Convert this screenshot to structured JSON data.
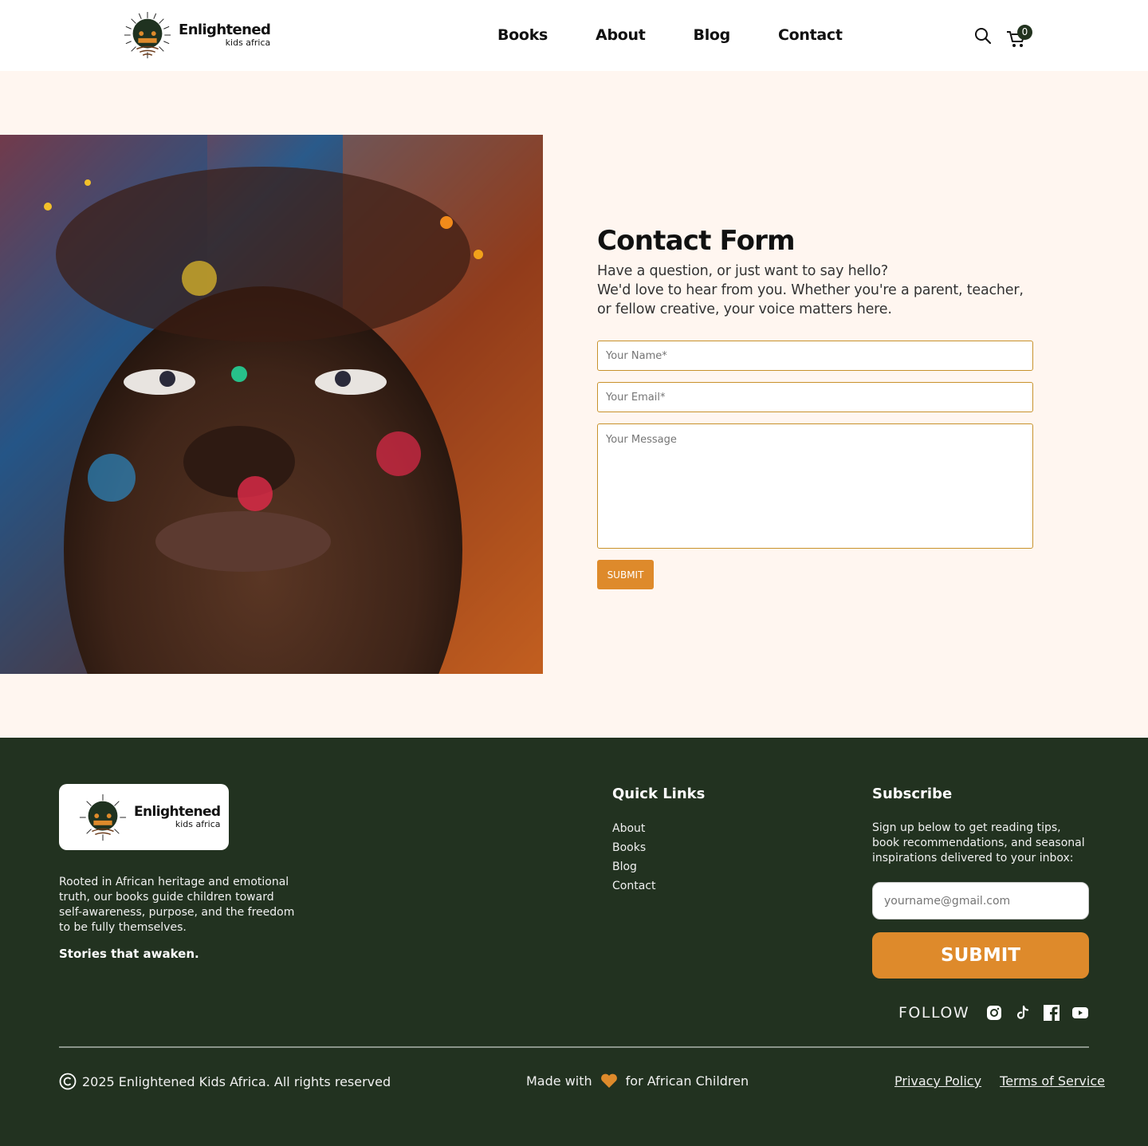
{
  "brand": {
    "name": "Enlightened",
    "sub": "kids africa"
  },
  "nav": {
    "items": [
      "Books",
      "About",
      "Blog",
      "Contact"
    ]
  },
  "cart": {
    "count": "0"
  },
  "contact": {
    "title": "Contact Form",
    "subtitle_line1": "Have a question,  or just want to say hello?",
    "subtitle_line2": "We'd love to hear from you. Whether you're a parent, teacher, or fellow creative, your voice matters here.",
    "name_placeholder": "Your Name*",
    "email_placeholder": "Your Email*",
    "message_placeholder": "Your Message",
    "submit_label": "SUBMIT"
  },
  "footer": {
    "about": "Rooted in African heritage and emotional truth, our books guide children toward self-awareness, purpose, and the freedom to be fully themselves.",
    "tagline": "Stories that awaken.",
    "quick_links_title": "Quick Links",
    "quick_links": [
      "About",
      "Books",
      "Blog",
      "Contact"
    ],
    "subscribe_title": "Subscribe",
    "subscribe_text": "Sign up below to get reading tips, book recommendations, and seasonal inspirations delivered to your inbox:",
    "email_placeholder": "yourname@gmail.com",
    "submit_label": "SUBMIT",
    "follow_label": "FOLLOW",
    "socials": [
      "instagram-icon",
      "tiktok-icon",
      "facebook-icon",
      "youtube-icon"
    ],
    "copyright": "2025 Enlightened Kids Africa. All rights reserved",
    "made_with": "Made with",
    "made_for": "for African Children",
    "privacy": "Privacy Policy",
    "terms": "Terms of Service"
  },
  "colors": {
    "accent": "#de8a2b",
    "footer_bg": "#223220",
    "page_bg": "#fff6f0",
    "field_border": "#c8922c"
  }
}
